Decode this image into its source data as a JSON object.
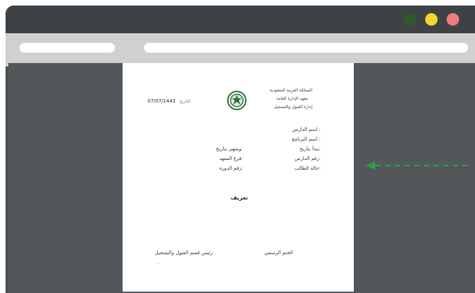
{
  "window": {
    "controls": [
      "minimize",
      "zoom",
      "close"
    ],
    "colors": {
      "green": "#2e5a29",
      "yellow": "#f2d52f",
      "red": "#ef7c7f"
    }
  },
  "document": {
    "header_right": [
      "المملكة العربية السعودية",
      "معهد الإدارة العامة",
      "إدارة القبول والتسجيل"
    ],
    "date_label": "التاريخ:",
    "date_value": "07/07/1443",
    "logo_icon": "institute-seal-icon",
    "fields_right": [
      "اسم الدارس :",
      "اسم البرنامج :",
      "يبدأ بتاريخ:",
      "رقم الدارس:",
      "حالة الطالب:"
    ],
    "fields_left": [
      "وينتهي بتاريخ:",
      "فرع المعهد:",
      "رقم الدورة:"
    ],
    "title": "تعريف",
    "signature_right": "الختم الرسمي",
    "signature_left": "رئيس قسم القبول والتسجيل"
  },
  "annotation": {
    "arrow_color": "#2ea043",
    "arrow_icon": "dashed-arrow-left-icon"
  }
}
